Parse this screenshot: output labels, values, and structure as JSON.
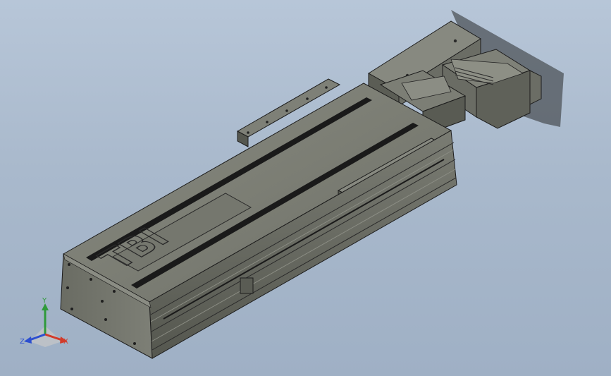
{
  "viewport": {
    "background_top": "#b7c6d8",
    "background_bottom": "#9fb0c5"
  },
  "model": {
    "body_color": "#6f7167",
    "edge_color": "#1c1c1c",
    "slot_color": "#1a1a1a",
    "logo_letters": "TBI"
  },
  "triad": {
    "x_label": "X",
    "y_label": "Y",
    "z_label": "Z",
    "x_color": "#d23b2a",
    "y_color": "#2f9a3a",
    "z_color": "#2c4fd0"
  }
}
